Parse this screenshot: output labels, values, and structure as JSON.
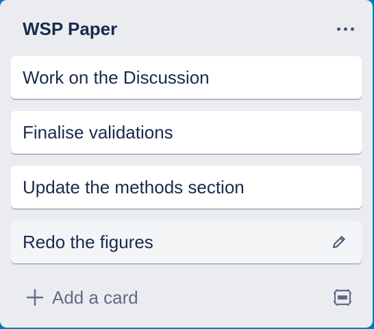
{
  "list": {
    "title": "WSP Paper",
    "menu_icon": "more-horizontal-icon",
    "cards": [
      {
        "text": "Work on the Discussion"
      },
      {
        "text": "Finalise validations"
      },
      {
        "text": "Update the methods section"
      },
      {
        "text": "Redo the figures",
        "edit_icon": "pencil-icon"
      }
    ],
    "add_card_label": "Add a card",
    "add_card_icon": "plus-icon",
    "template_icon": "card-template-icon"
  },
  "colors": {
    "list_background": "#ebecf0",
    "card_background": "#ffffff",
    "card_hover_background": "#f4f5f7",
    "text": "#172b4d",
    "muted_text": "#5e6c84"
  }
}
